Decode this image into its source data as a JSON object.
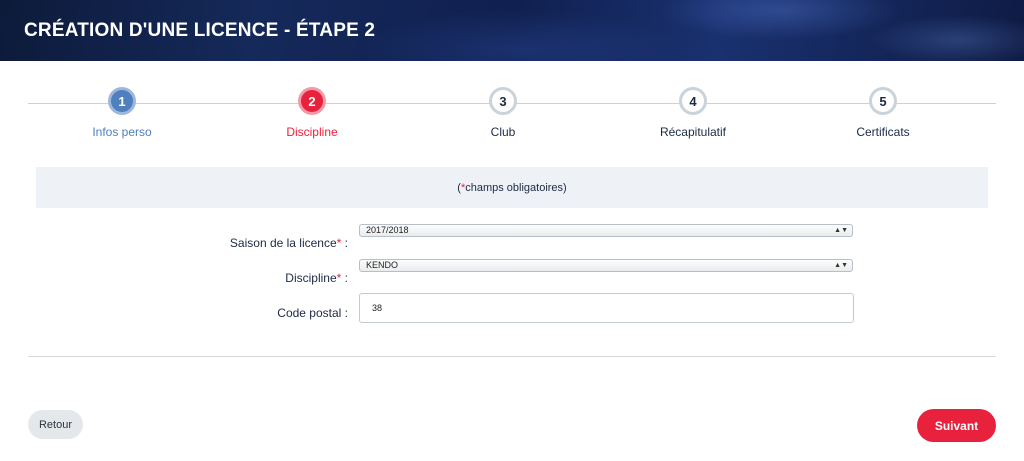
{
  "header": {
    "title": "CRÉATION D'UNE LICENCE - ÉTAPE 2"
  },
  "steps": [
    {
      "number": "1",
      "label": "Infos perso",
      "state": "done"
    },
    {
      "number": "2",
      "label": "Discipline",
      "state": "active"
    },
    {
      "number": "3",
      "label": "Club",
      "state": "pending"
    },
    {
      "number": "4",
      "label": "Récapitulatif",
      "state": "pending"
    },
    {
      "number": "5",
      "label": "Certificats",
      "state": "pending"
    }
  ],
  "notice": {
    "open": "(",
    "asterisk": "*",
    "text": " champs obligatoires)"
  },
  "form": {
    "saison": {
      "label": "Saison de la licence",
      "asterisk": "*",
      "suffix": " :",
      "value": "2017/2018"
    },
    "discipline": {
      "label": "Discipline",
      "asterisk": "*",
      "suffix": " :",
      "value": "KENDO"
    },
    "code_postal": {
      "label": "Code postal :",
      "value": "38"
    }
  },
  "buttons": {
    "back": "Retour",
    "next": "Suivant"
  },
  "colors": {
    "accent": "#e8223c",
    "done": "#4e80bf",
    "text": "#1c2a44",
    "header": "#122453"
  }
}
